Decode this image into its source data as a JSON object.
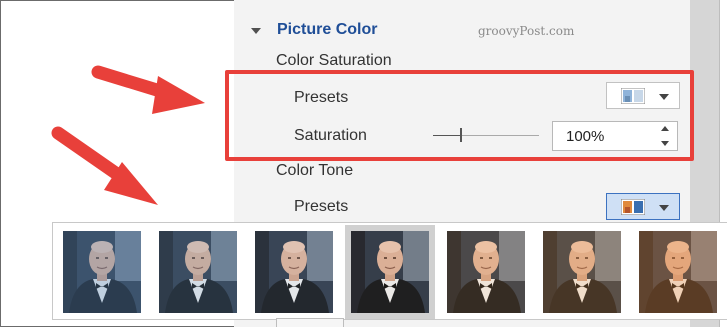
{
  "format_pane": {
    "section_title": "Picture Color",
    "watermark": "groovyPost.com",
    "color_saturation": {
      "group_label": "Color Saturation",
      "presets_label": "Presets",
      "saturation_label": "Saturation",
      "saturation_value": "100%",
      "slider_level_percent": 25
    },
    "color_tone": {
      "group_label": "Color Tone",
      "presets_label": "Presets",
      "dropdown_open": true
    }
  },
  "gallery": {
    "selected_index": 3,
    "presets": [
      {
        "tint": "#5b8ab8",
        "opacity": 0.35
      },
      {
        "tint": "#6d93b8",
        "opacity": 0.25
      },
      {
        "tint": "#8aa2b8",
        "opacity": 0.15
      },
      {
        "tint": "#9a8a72",
        "opacity": 0.1
      },
      {
        "tint": "#e0a060",
        "opacity": 0.18
      },
      {
        "tint": "#e59a50",
        "opacity": 0.26
      },
      {
        "tint": "#e88c40",
        "opacity": 0.34
      }
    ]
  },
  "colors": {
    "accent": "#1f4e97",
    "annotation_red": "#e8403a",
    "active_dropdown": "#cfe0f5"
  },
  "icons": {
    "collapse": "triangle-down-icon",
    "preset_thumb": "color-preset-icon",
    "dropdown": "chevron-down-icon",
    "spin_up": "spin-up-icon",
    "spin_down": "spin-down-icon"
  }
}
